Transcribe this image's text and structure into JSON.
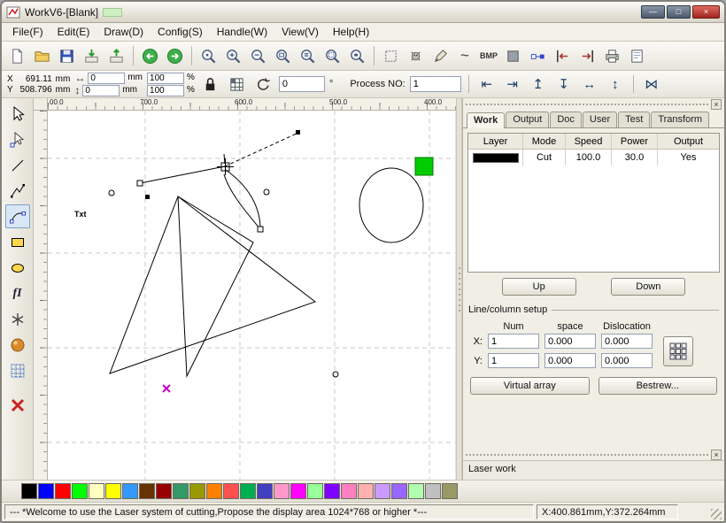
{
  "window": {
    "title": "WorkV6-[Blank]",
    "controls": {
      "minimize": "—",
      "maximize": "□",
      "close": "×"
    }
  },
  "menu": {
    "items": [
      "File(F)",
      "Edit(E)",
      "Draw(D)",
      "Config(S)",
      "Handle(W)",
      "View(V)",
      "Help(H)"
    ]
  },
  "icons": {
    "curve": "~",
    "bmp": "BMP",
    "text_tool": "fI",
    "width_arrow": "↔",
    "height_arrow": "↕",
    "align_left": "⇤",
    "align_right": "⇥",
    "align_top": "↥",
    "align_bottom": "↧",
    "mirror_h": "↔",
    "mirror_v": "↕",
    "weld": "⋈"
  },
  "toolbar2": {
    "coords": {
      "x_label": "X",
      "x_value": "691.11",
      "x_unit": "mm",
      "y_label": "Y",
      "y_value": "508.796",
      "y_unit": "mm"
    },
    "size": {
      "w_value": "0",
      "w_unit": "mm",
      "h_value": "0",
      "h_unit": "mm",
      "w_pct": "100",
      "h_pct": "100",
      "pct": "%"
    },
    "rotate": {
      "value": "0",
      "unit": "°"
    },
    "process": {
      "label": "Process NO:",
      "value": "1"
    }
  },
  "ruler": {
    "top_labels": [
      "00.0",
      "700.0",
      "600.0",
      "500.0",
      "400.0"
    ]
  },
  "canvas": {
    "text_label": "Txt",
    "green_square_color": "#00CC00",
    "marker_color": "#CC00CC"
  },
  "panel": {
    "close_glyph": "×",
    "tabs": [
      "Work",
      "Output",
      "Doc",
      "User",
      "Test",
      "Transform"
    ],
    "active_tab": "Work",
    "table": {
      "headers": [
        "Layer",
        "Mode",
        "Speed",
        "Power",
        "Output"
      ],
      "row": {
        "layer_color": "#000000",
        "mode": "Cut",
        "speed": "100.0",
        "power": "30.0",
        "output": "Yes"
      }
    },
    "up": "Up",
    "down": "Down",
    "linecol": {
      "title": "Line/column setup",
      "col_num": "Num",
      "col_space": "space",
      "col_dis": "Dislocation",
      "x_label": "X:",
      "y_label": "Y:",
      "x_num": "1",
      "x_space": "0.000",
      "x_dis": "0.000",
      "y_num": "1",
      "y_space": "0.000",
      "y_dis": "0.000",
      "virtual_array": "Virtual array",
      "bestrew": "Bestrew..."
    },
    "laser_work": "Laser work"
  },
  "palette": {
    "colors": [
      "#000000",
      "#0000FF",
      "#FF0000",
      "#00FF00",
      "#FFFFBF",
      "#FFFF00",
      "#3399FF",
      "#663300",
      "#990000",
      "#339966",
      "#999900",
      "#FF8000",
      "#FF5050",
      "#00B050",
      "#4040C0",
      "#FF99CC",
      "#FF00FF",
      "#99FF99",
      "#8000FF",
      "#FF80C0",
      "#FFB0B0",
      "#CC99FF",
      "#9966FF",
      "#B0FFB0",
      "#C0C0C0",
      "#999966"
    ]
  },
  "statusbar": {
    "message": "--- *Welcome to use the Laser system of cutting,Propose the display area 1024*768 or higher *---",
    "coords": "X:400.861mm,Y:372.264mm"
  }
}
